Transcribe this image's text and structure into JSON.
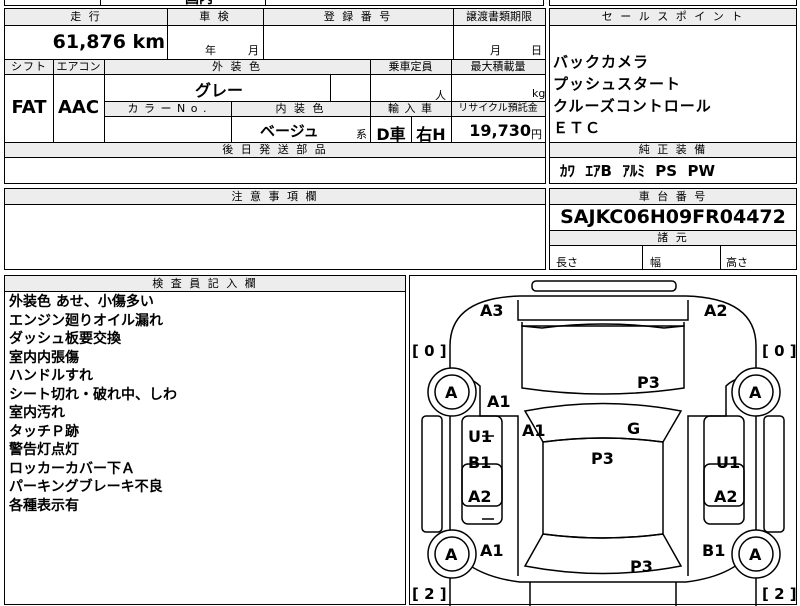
{
  "top_strip": {
    "partial_text": "国内"
  },
  "left_grid": {
    "mileage_label": "走 行",
    "mileage_value": "61,876 km",
    "inspection_label": "車 検",
    "inspection_year": "年",
    "inspection_month": "月",
    "registration_label": "登 録 番 号",
    "transfer_label": "譲渡書類期限",
    "transfer_month": "月",
    "transfer_day": "日",
    "shift_label": "シフト",
    "aircon_label": "エアコン",
    "exterior_color_label": "外 装 色",
    "capacity_label": "乗車定員",
    "max_load_label": "最大積載量",
    "shift_value": "FAT",
    "aircon_value": "AAC",
    "exterior_color_value": "グレー",
    "capacity_unit": "人",
    "max_load_unit": "kg",
    "color_no_label": "カ ラ ー N o .",
    "interior_color_label": "内 装 色",
    "import_label": "輸 入 車",
    "recycle_label": "リサイクル預託金",
    "interior_color_value": "ベージュ",
    "interior_color_suffix": "系",
    "import_dealer": "D車",
    "import_handle": "右H",
    "recycle_value": "19,730",
    "recycle_unit": "円",
    "post_parts_label": "後 日 発 送 部 品"
  },
  "sales_point": {
    "label": "セ ー ル ス ポ イ ン ト",
    "items": [
      "バックカメラ",
      "プッシュスタート",
      "クルーズコントロール",
      "ＥＴＣ"
    ],
    "genuine_label": "純 正 装 備",
    "genuine_value": "ｶﾜ  ｴｱB  ｱﾙﾐ  PS  PW"
  },
  "notes": {
    "label": "注 意 事 項 欄"
  },
  "chassis": {
    "label": "車 台 番 号",
    "value": "SAJKC06H09FR04472",
    "dims_label": "諸 元",
    "length_label": "長さ",
    "width_label": "幅",
    "height_label": "高さ"
  },
  "inspector": {
    "label": "検 査 員 記 入 欄",
    "lines": [
      "外装色 あせ、小傷多い",
      "エンジン廻りオイル漏れ",
      "ダッシュ板要交換",
      "室内内張傷",
      "ハンドルすれ",
      "シート切れ・破れ中、しわ",
      "室内汚れ",
      "タッチＰ跡",
      "警告灯点灯",
      "ロッカーカバー下Ａ",
      "パーキングブレーキ不良",
      "各種表示有"
    ]
  },
  "diagram": {
    "marks": {
      "front_left": "A3",
      "front_right": "A2",
      "tire_count_fl": "[ 0 ]",
      "tire_count_fr": "[ 0 ]",
      "tire_count_rl": "[ 2 ]",
      "tire_count_rr": "[ 2 ]",
      "wheel_fl": "A",
      "wheel_fr": "A",
      "wheel_rl": "A",
      "wheel_rr": "A",
      "hood": "P3",
      "fender_l": "A1",
      "pillar_l": "A1",
      "windshield": "G",
      "door_fl": "U1",
      "door_fl_2": "B1",
      "door_fr": "U1",
      "roof": "P3",
      "door_rl": "A2",
      "door_rr": "A2",
      "quarter_l": "A1",
      "quarter_r": "B1",
      "trunk": "P3"
    }
  }
}
